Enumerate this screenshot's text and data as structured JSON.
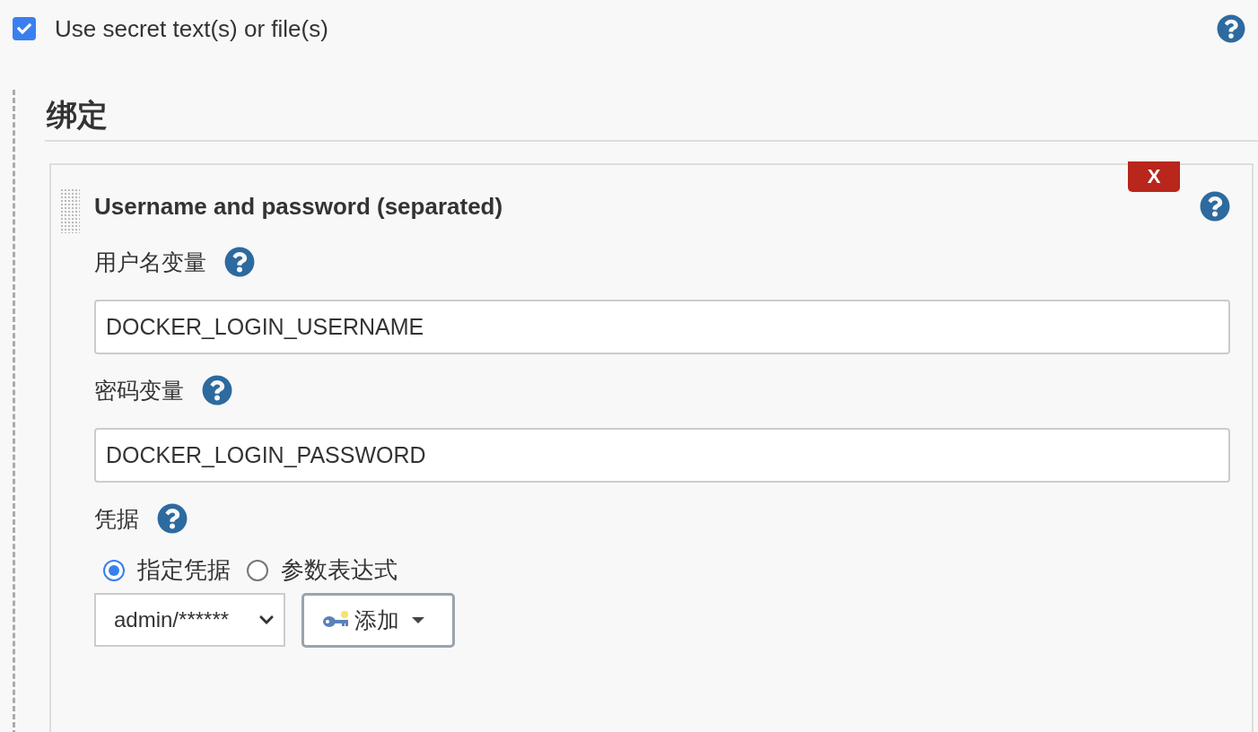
{
  "option": {
    "label": "Use secret text(s) or file(s)",
    "checked": true
  },
  "section": {
    "title": "绑定"
  },
  "binding": {
    "title": "Username and password (separated)",
    "delete_button": {
      "label": "X"
    },
    "fields": [
      {
        "label": "用户名变量",
        "value": "DOCKER_LOGIN_USERNAME"
      },
      {
        "label": "密码变量",
        "value": "DOCKER_LOGIN_PASSWORD"
      }
    ],
    "credentials": {
      "label": "凭据",
      "modes": [
        {
          "label": "指定凭据",
          "selected": true
        },
        {
          "label": "参数表达式",
          "selected": false
        }
      ],
      "select": {
        "value": "admin/******"
      },
      "add_button": {
        "label": "添加"
      }
    }
  }
}
